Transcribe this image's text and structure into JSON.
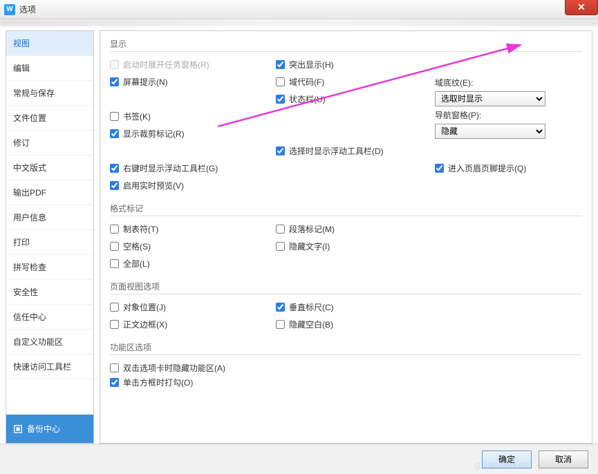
{
  "window": {
    "title": "选项",
    "close": "✕"
  },
  "sidebar": {
    "items": [
      {
        "label": "视图"
      },
      {
        "label": "编辑"
      },
      {
        "label": "常规与保存"
      },
      {
        "label": "文件位置"
      },
      {
        "label": "修订"
      },
      {
        "label": "中文版式"
      },
      {
        "label": "输出PDF"
      },
      {
        "label": "用户信息"
      },
      {
        "label": "打印"
      },
      {
        "label": "拼写检查"
      },
      {
        "label": "安全性"
      },
      {
        "label": "信任中心"
      },
      {
        "label": "自定义功能区"
      },
      {
        "label": "快速访问工具栏"
      }
    ],
    "backup_label": "备份中心"
  },
  "groups": {
    "display": {
      "title": "显示",
      "left": [
        {
          "label": "启动时展开任务窗格(R)",
          "checked": false,
          "disabled": true
        },
        {
          "label": "屏幕提示(N)",
          "checked": true
        },
        {
          "label": "状态栏(U)",
          "checked": true
        },
        {
          "label": "显示裁剪标记(R)",
          "checked": true
        },
        {
          "label": "选择时显示浮动工具栏(D)",
          "checked": true
        },
        {
          "label": "进入页眉页脚提示(Q)",
          "checked": true
        }
      ],
      "mid": [
        {
          "label": "突出显示(H)",
          "checked": true
        },
        {
          "label": "域代码(F)",
          "checked": false
        },
        {
          "label": "书签(K)",
          "checked": false
        },
        {
          "label": "",
          "skip": true
        },
        {
          "label": "右键时显示浮动工具栏(G)",
          "checked": true
        },
        {
          "label": "启用实时预览(V)",
          "checked": true
        }
      ],
      "right": {
        "shading_label": "域底纹(E):",
        "shading_value": "选取时显示",
        "nav_label": "导航窗格(P):",
        "nav_value": "隐藏"
      }
    },
    "marks": {
      "title": "格式标记",
      "left": [
        {
          "label": "制表符(T)",
          "checked": false
        },
        {
          "label": "空格(S)",
          "checked": false
        },
        {
          "label": "全部(L)",
          "checked": false
        }
      ],
      "mid": [
        {
          "label": "段落标记(M)",
          "checked": false
        },
        {
          "label": "隐藏文字(I)",
          "checked": false
        }
      ]
    },
    "pageview": {
      "title": "页面视图选项",
      "left": [
        {
          "label": "对象位置(J)",
          "checked": false
        },
        {
          "label": "正文边框(X)",
          "checked": false
        }
      ],
      "mid": [
        {
          "label": "垂直标尺(C)",
          "checked": true
        },
        {
          "label": "隐藏空白(B)",
          "checked": false
        }
      ]
    },
    "ribbon": {
      "title": "功能区选项",
      "items": [
        {
          "label": "双击选项卡时隐藏功能区(A)",
          "checked": false
        },
        {
          "label": "单击方框时打勾(O)",
          "checked": true
        }
      ]
    }
  },
  "footer": {
    "ok": "确定",
    "cancel": "取消"
  },
  "watermark": "g.yancald.co"
}
